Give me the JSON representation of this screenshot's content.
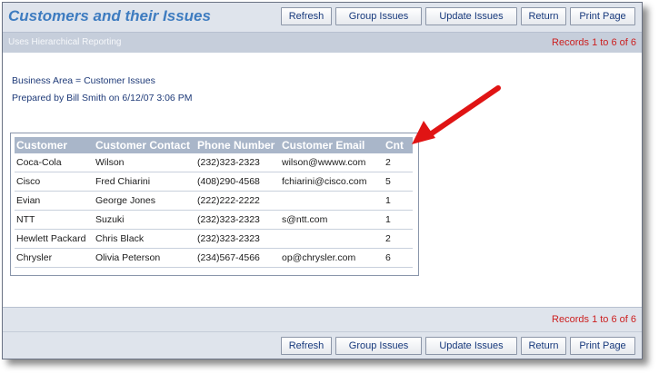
{
  "header": {
    "title": "Customers and their Issues"
  },
  "toolbar": {
    "buttons": [
      "Refresh",
      "Group Issues",
      "Update Issues",
      "Return",
      "Print Page"
    ]
  },
  "subheader": {
    "text": "Uses Hierarchical Reporting",
    "records": "Records 1 to 6 of 6"
  },
  "info": {
    "business_area": "Business Area = Customer Issues",
    "prepared_by": "Prepared by Bill Smith on 6/12/07 3:06 PM"
  },
  "table": {
    "headers": [
      "Customer",
      "Customer Contact",
      "Phone Number",
      "Customer Email",
      "Cnt"
    ],
    "rows": [
      [
        "Coca-Cola",
        "Wilson",
        "(232)323-2323",
        "wilson@wwww.com",
        "2"
      ],
      [
        "Cisco",
        "Fred Chiarini",
        "(408)290-4568",
        "fchiarini@cisco.com",
        "5"
      ],
      [
        "Evian",
        "George Jones",
        "(222)222-2222",
        "",
        "1"
      ],
      [
        "NTT",
        "Suzuki",
        "(232)323-2323",
        "s@ntt.com",
        "1"
      ],
      [
        "Hewlett Packard",
        "Chris Black",
        "(232)323-2323",
        "",
        "2"
      ],
      [
        "Chrysler",
        "Olivia Peterson",
        "(234)567-4566",
        "op@chrysler.com",
        "6"
      ]
    ]
  },
  "footer": {
    "records": "Records 1 to 6 of 6"
  },
  "colors": {
    "title": "#3e7cc0",
    "records": "#cc1f1f",
    "header_bg": "#a9b6c9",
    "arrow": "#e01414"
  }
}
